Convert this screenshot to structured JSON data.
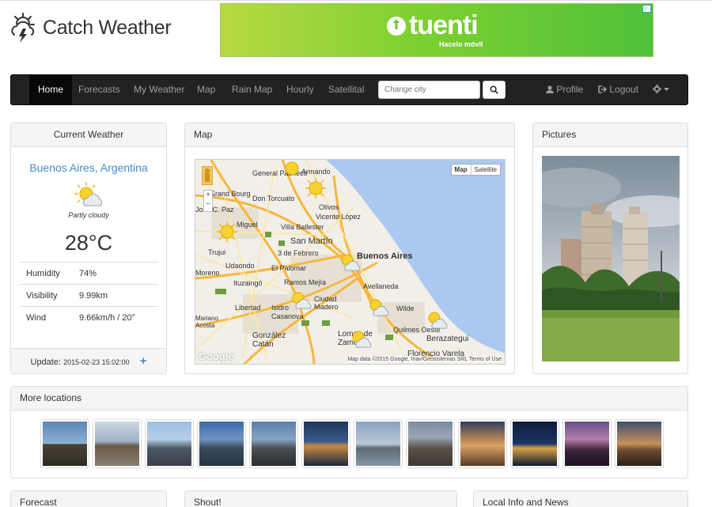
{
  "header": {
    "logo_text": "Catch Weather",
    "ad": {
      "brand": "tuenti",
      "tagline": "Hacelo móvil",
      "badge": "▷"
    }
  },
  "nav": {
    "items": [
      "Home",
      "Forecasts",
      "My Weather",
      "Map",
      "Rain Map",
      "Hourly",
      "Satellital"
    ],
    "active": "Home",
    "search_placeholder": "Change city",
    "profile": "Profile",
    "logout": "Logout"
  },
  "current": {
    "title": "Current Weather",
    "city": "Buenos Aires, Argentina",
    "condition": "Partly cloudy",
    "temperature": "28°C",
    "rows": [
      {
        "label": "Humidity",
        "value": "74%"
      },
      {
        "label": "Visibility",
        "value": "9.99km"
      },
      {
        "label": "Wind",
        "value": "9.66km/h / 20°"
      }
    ],
    "update_label": "Update:",
    "update_time": "2015-02-23 15:02:00",
    "add_icon": "+"
  },
  "map": {
    "title": "Map",
    "btn_map": "Map",
    "btn_satellite": "Satellite",
    "attribution": "Map data ©2015 Google, Inav/Geosistemas SRL   Terms of Use",
    "google": "Google",
    "labels": [
      "General Pacheco",
      "Armando",
      "Grand Bourg",
      "Don Torcuato",
      "Olivos",
      "Vicente López",
      "José C. Paz",
      "Miguel",
      "Villa Ballester",
      "San Martín",
      "Trujui",
      "3 de Febrero",
      "Buenos Aires",
      "Udaondo",
      "El Palomar",
      "Moreno",
      "Ituzaingó",
      "Ramos Mejía",
      "Avellaneda",
      "Libertad",
      "Isidro Casanova",
      "Ciudad Madero",
      "Wilde",
      "Mariano Acosta",
      "Quilmes Oeste",
      "González Catán",
      "Lomas de Zamora",
      "Berazategui",
      "Florencio Varela"
    ]
  },
  "pictures": {
    "title": "Pictures"
  },
  "more": {
    "title": "More locations"
  },
  "bottom": {
    "forecast": "Forecast",
    "shout": "Shout!",
    "local": "Local Info and News"
  }
}
